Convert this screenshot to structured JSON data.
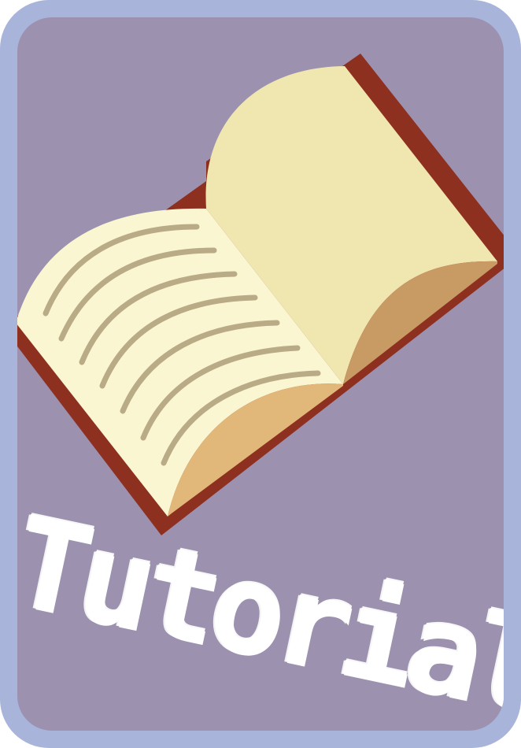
{
  "card": {
    "title": "Tutorial",
    "icon": "open-book-icon"
  },
  "colors": {
    "frame": "#a8b4da",
    "panel": "#9c92b0",
    "book_cover": "#8e3020",
    "left_page": "#fbf6d2",
    "right_page": "#f0e6b0",
    "page_edge_left": "#e2b87a",
    "page_edge_right": "#c89a64",
    "text_lines": "#b9ab86",
    "title_text": "#ffffff"
  }
}
